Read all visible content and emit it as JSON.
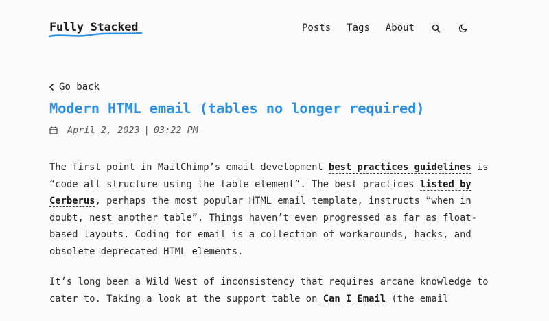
{
  "header": {
    "logo": "Fully Stacked",
    "nav": [
      "Posts",
      "Tags",
      "About"
    ],
    "icons": [
      "search-icon",
      "moon-icon"
    ]
  },
  "post": {
    "back_label": "Go back",
    "title": "Modern HTML email (tables no longer required)",
    "date": "April 2, 2023",
    "separator": "|",
    "time": "03:22 PM"
  },
  "body": {
    "p1": {
      "t1": "The first point in MailChimp’s email development ",
      "l1": "best practices guidelines",
      "t2": " is “code all structure using the table element”. The best practices ",
      "l2": "listed by Cerberus",
      "t3": ", perhaps the most popular HTML email template, instructs “when in doubt, nest another table”. Things haven’t even progressed as far as float-based layouts. Coding for email is a collection of workarounds, hacks, and obsolete deprecated HTML elements."
    },
    "p2": {
      "t1": "It’s long been a Wild West of inconsistency that requires arcane knowledge to cater to. Taking a look at the support table on ",
      "l1": "Can I Email",
      "t2": " (the email"
    }
  },
  "colors": {
    "accent": "#2d8fe0",
    "background": "#fafafa",
    "text": "#2e2e2e"
  }
}
